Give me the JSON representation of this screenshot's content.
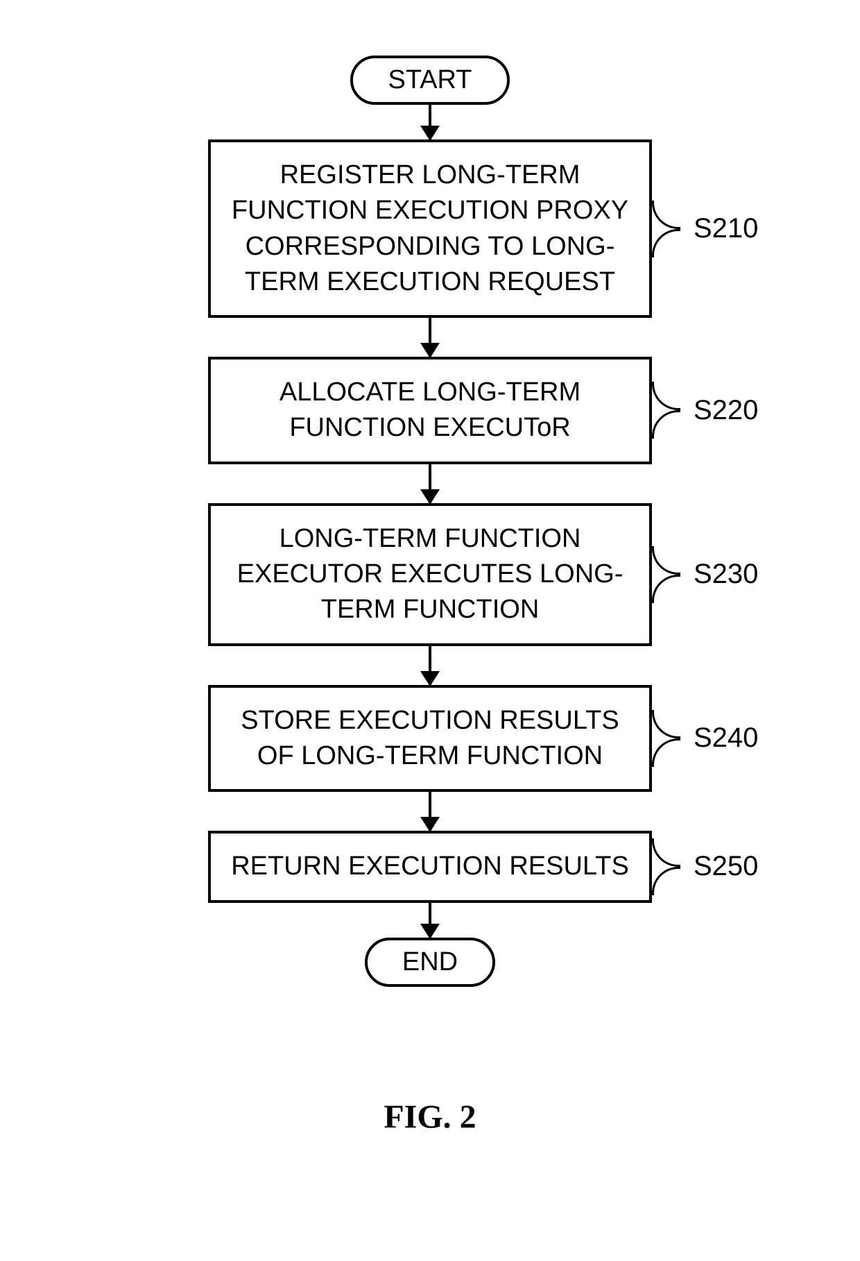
{
  "start": "START",
  "end": "END",
  "figure": "FIG. 2",
  "steps": [
    {
      "label": "S210",
      "text": "REGISTER LONG-TERM FUNCTION EXECUTION PROXY CORRESPONDING TO LONG-TERM EXECUTION REQUEST"
    },
    {
      "label": "S220",
      "text": "ALLOCATE LONG-TERM FUNCTION EXECUToR"
    },
    {
      "label": "S230",
      "text": "LONG-TERM FUNCTION EXECUTOR EXECUTES LONG-TERM FUNCTION"
    },
    {
      "label": "S240",
      "text": "STORE EXECUTION RESULTS OF LONG-TERM FUNCTION"
    },
    {
      "label": "S250",
      "text": "RETURN EXECUTION RESULTS"
    }
  ]
}
